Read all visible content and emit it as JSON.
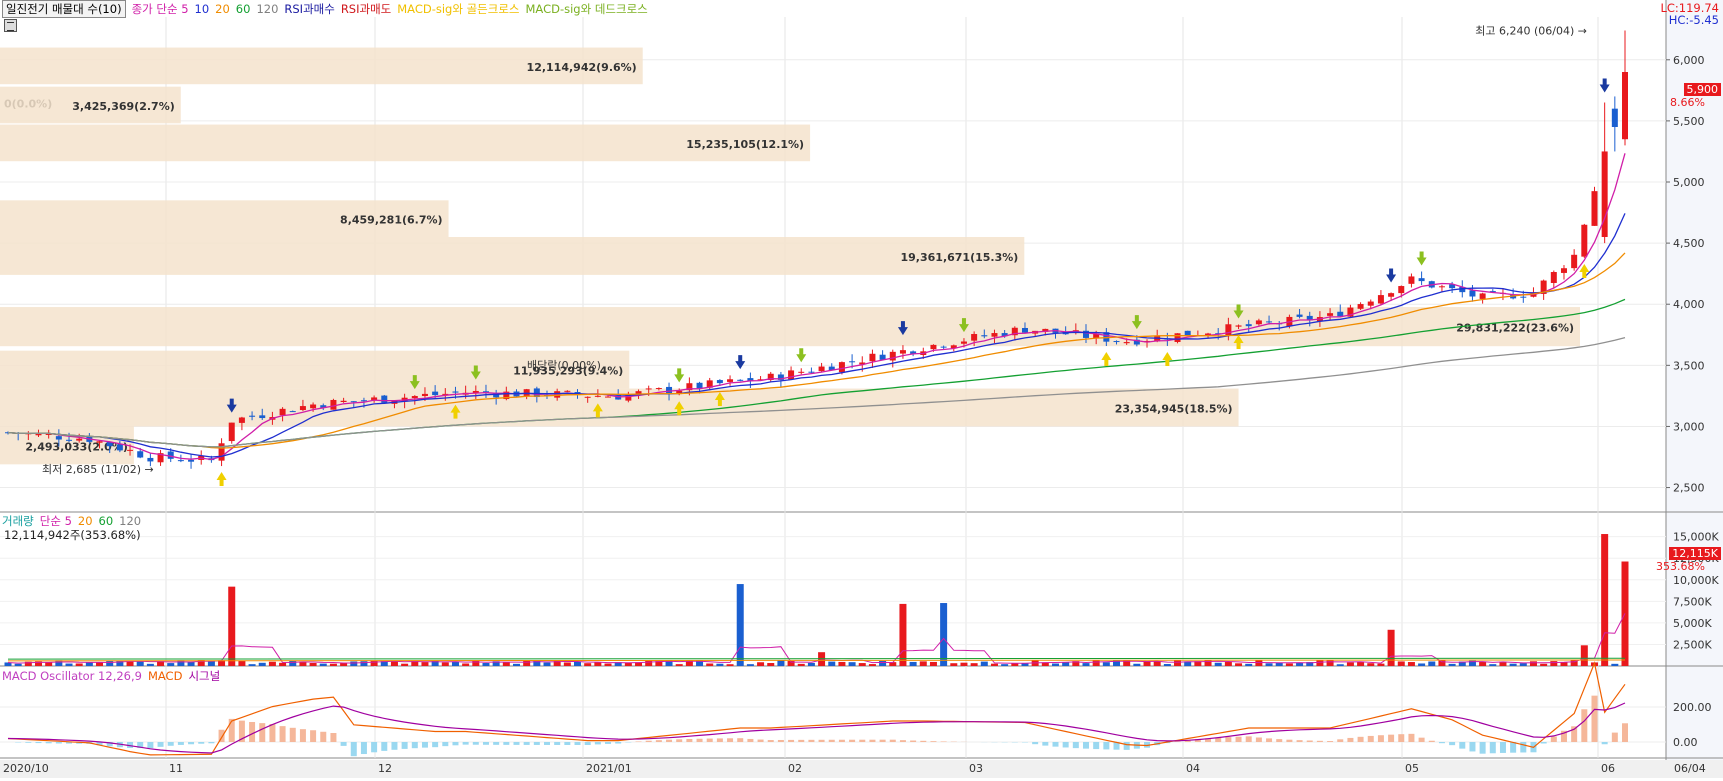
{
  "price_panel": {
    "title": "일진전기 매물대 수(10)",
    "legend": [
      {
        "label": "종가 단순 5",
        "color": "#d01ea8"
      },
      {
        "label": "10",
        "color": "#1f2fd0"
      },
      {
        "label": "20",
        "color": "#f08c00"
      },
      {
        "label": "60",
        "color": "#14a032"
      },
      {
        "label": "120",
        "color": "#808080"
      },
      {
        "label": "RSI과매수",
        "color": "#1a1aa0"
      },
      {
        "label": "RSI과매도",
        "color": "#d0191d"
      },
      {
        "label": "MACD-sig와 골든크로스",
        "color": "#f0c000"
      },
      {
        "label": "MACD-sig와 데드크로스",
        "color": "#7ab020"
      }
    ],
    "lc_label": "LC:119.74",
    "hc_label": "HC:-5.45",
    "current_price": "5,900",
    "current_change": "8.66%",
    "high_annotation": "최고 6,240 (06/04) →",
    "low_annotation": "최저 2,685 (11/02) →",
    "dividend_annotation": "배당락(0.00%)",
    "range_annotation": "29,831,222(23.6%)(3,977.00 ~ 3,656.50)",
    "y_ticks": [
      "6,000",
      "5,500",
      "5,000",
      "4,500",
      "4,000",
      "3,500",
      "3,000",
      "2,500"
    ]
  },
  "volume_panel": {
    "legend": [
      {
        "label": "거래량",
        "color": "#1aa0a0"
      },
      {
        "label": "단순 5",
        "color": "#d01ea8"
      },
      {
        "label": "20",
        "color": "#f08c00"
      },
      {
        "label": "60",
        "color": "#14a032"
      },
      {
        "label": "120",
        "color": "#808080"
      }
    ],
    "last_volume_text": "12,114,942주(353.68%)",
    "current_value": "12,115K",
    "current_pct": "353.68%",
    "y_ticks": [
      "15,000K",
      "12,500K",
      "10,000K",
      "7,500K",
      "5,000K",
      "2,500K"
    ]
  },
  "macd_panel": {
    "legend": [
      {
        "label": "MACD Oscillator 12,26,9",
        "color": "#c040c0"
      },
      {
        "label": "MACD",
        "color": "#f06000"
      },
      {
        "label": "시그널",
        "color": "#a000a0"
      }
    ],
    "y_ticks": [
      "200.00",
      "0.00"
    ]
  },
  "x_axis": {
    "ticks": [
      "2020/10",
      "11",
      "12",
      "2021/01",
      "02",
      "03",
      "04",
      "05",
      "06",
      "06/04"
    ]
  },
  "chart_data": {
    "type": "candlestick",
    "title": "일진전기 매물대 수(10)",
    "x_range": [
      "2020/10",
      "06/04"
    ],
    "y_range": [
      2300,
      6350
    ],
    "volume_profile": [
      {
        "label": "0(0.0%)",
        "price_low": 5500,
        "price_high": 5800,
        "volume": 0,
        "pct": 0.0
      },
      {
        "label": "12,114,942(9.6%)",
        "price_low": 5800,
        "price_high": 6100,
        "volume": 12114942,
        "pct": 9.6
      },
      {
        "label": "3,425,369(2.7%)",
        "price_low": 5480,
        "price_high": 5780,
        "volume": 3425369,
        "pct": 2.7
      },
      {
        "label": "15,235,105(12.1%)",
        "price_low": 5170,
        "price_high": 5470,
        "volume": 15235105,
        "pct": 12.1
      },
      {
        "label": "8,459,281(6.7%)",
        "price_low": 4550,
        "price_high": 4850,
        "volume": 8459281,
        "pct": 6.7
      },
      {
        "label": "19,361,671(15.3%)",
        "price_low": 4240,
        "price_high": 4550,
        "volume": 19361671,
        "pct": 15.3
      },
      {
        "label": "29,831,222(23.6%)",
        "price_low": 3656.5,
        "price_high": 3977,
        "volume": 29831222,
        "pct": 23.6
      },
      {
        "label": "11,935,293(9.4%)",
        "price_low": 3310,
        "price_high": 3620,
        "volume": 11935293,
        "pct": 9.4
      },
      {
        "label": "23,354,945(18.5%)",
        "price_low": 3000,
        "price_high": 3310,
        "volume": 23354945,
        "pct": 18.5
      },
      {
        "label": "2,493,033(2.0%)",
        "price_low": 2690,
        "price_high": 3000,
        "volume": 2493033,
        "pct": 2.0
      }
    ],
    "highest": {
      "date": "06/04",
      "price": 6240
    },
    "lowest": {
      "date": "11/02",
      "price": 2685
    },
    "last_close": 5900,
    "last_change_pct": 8.66,
    "last_volume": 12114942,
    "volume_max_tick": 15000
  }
}
